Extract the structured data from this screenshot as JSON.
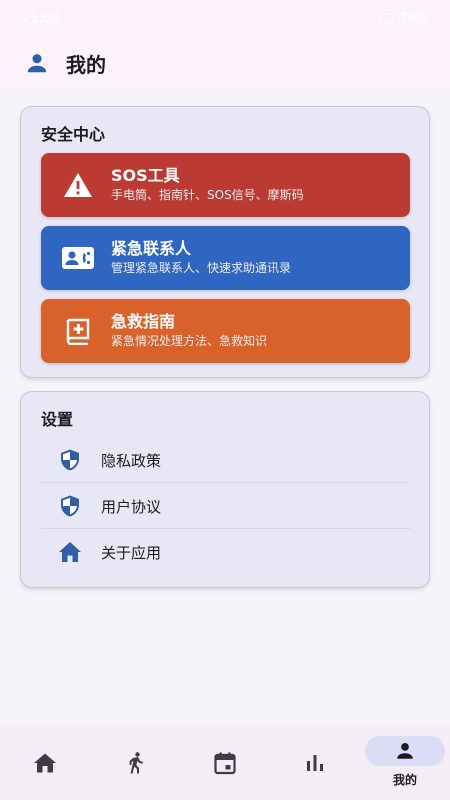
{
  "status_bar": {
    "time": "21:00",
    "battery": "76%"
  },
  "header": {
    "title": "我的",
    "icon": "person-icon"
  },
  "security": {
    "title": "安全中心",
    "items": [
      {
        "name": "SOS工具",
        "desc": "手电筒、指南针、SOS信号、摩斯码",
        "icon": "warning-icon",
        "color": "#bb3b33"
      },
      {
        "name": "紧急联系人",
        "desc": "管理紧急联系人、快速求助通讯录",
        "icon": "contact-card-icon",
        "color": "#2f66c1"
      },
      {
        "name": "急救指南",
        "desc": "紧急情况处理方法、急救知识",
        "icon": "first-aid-book-icon",
        "color": "#d9612a"
      }
    ]
  },
  "settings": {
    "title": "设置",
    "items": [
      {
        "label": "隐私政策",
        "icon": "shield-icon"
      },
      {
        "label": "用户协议",
        "icon": "shield-icon"
      },
      {
        "label": "关于应用",
        "icon": "home-icon"
      }
    ]
  },
  "bottom_nav": {
    "items": [
      {
        "icon": "home-icon"
      },
      {
        "icon": "running-icon"
      },
      {
        "icon": "calendar-icon"
      },
      {
        "icon": "bar-chart-icon"
      },
      {
        "icon": "person-icon",
        "label": "我的",
        "active": true
      }
    ]
  },
  "colors": {
    "accent": "#2f5fa8",
    "icon": "#2f5fa8"
  }
}
